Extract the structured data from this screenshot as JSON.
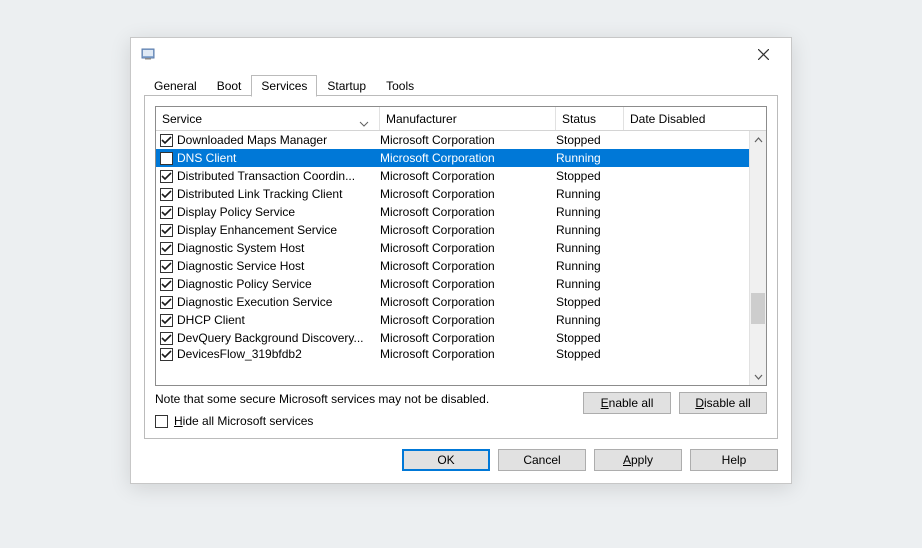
{
  "tabs": {
    "general": "General",
    "boot": "Boot",
    "services": "Services",
    "startup": "Startup",
    "tools": "Tools"
  },
  "columns": {
    "service": "Service",
    "manufacturer": "Manufacturer",
    "status": "Status",
    "date_disabled": "Date Disabled"
  },
  "services": [
    {
      "name": "Downloaded Maps Manager",
      "mfr": "Microsoft Corporation",
      "status": "Stopped",
      "checked": true,
      "selected": false
    },
    {
      "name": "DNS Client",
      "mfr": "Microsoft Corporation",
      "status": "Running",
      "checked": false,
      "selected": true
    },
    {
      "name": "Distributed Transaction Coordin...",
      "mfr": "Microsoft Corporation",
      "status": "Stopped",
      "checked": true,
      "selected": false
    },
    {
      "name": "Distributed Link Tracking Client",
      "mfr": "Microsoft Corporation",
      "status": "Running",
      "checked": true,
      "selected": false
    },
    {
      "name": "Display Policy Service",
      "mfr": "Microsoft Corporation",
      "status": "Running",
      "checked": true,
      "selected": false
    },
    {
      "name": "Display Enhancement Service",
      "mfr": "Microsoft Corporation",
      "status": "Running",
      "checked": true,
      "selected": false
    },
    {
      "name": "Diagnostic System Host",
      "mfr": "Microsoft Corporation",
      "status": "Running",
      "checked": true,
      "selected": false
    },
    {
      "name": "Diagnostic Service Host",
      "mfr": "Microsoft Corporation",
      "status": "Running",
      "checked": true,
      "selected": false
    },
    {
      "name": "Diagnostic Policy Service",
      "mfr": "Microsoft Corporation",
      "status": "Running",
      "checked": true,
      "selected": false
    },
    {
      "name": "Diagnostic Execution Service",
      "mfr": "Microsoft Corporation",
      "status": "Stopped",
      "checked": true,
      "selected": false
    },
    {
      "name": "DHCP Client",
      "mfr": "Microsoft Corporation",
      "status": "Running",
      "checked": true,
      "selected": false
    },
    {
      "name": "DevQuery Background Discovery...",
      "mfr": "Microsoft Corporation",
      "status": "Stopped",
      "checked": true,
      "selected": false
    },
    {
      "name": "DevicesFlow_319bfdb2",
      "mfr": "Microsoft Corporation",
      "status": "Stopped",
      "checked": true,
      "selected": false
    }
  ],
  "note": "Note that some secure Microsoft services may not be disabled.",
  "hide_label_pre": "H",
  "hide_label_post": "ide all Microsoft services",
  "buttons": {
    "enable_all_pre": "E",
    "enable_all_post": "nable all",
    "disable_all_pre": "D",
    "disable_all_post": "isable all",
    "ok": "OK",
    "cancel": "Cancel",
    "apply_pre": "A",
    "apply_post": "pply",
    "help": "Help"
  },
  "scrollbar": {
    "thumb_top_pct": 66,
    "thumb_height_pct": 14
  }
}
